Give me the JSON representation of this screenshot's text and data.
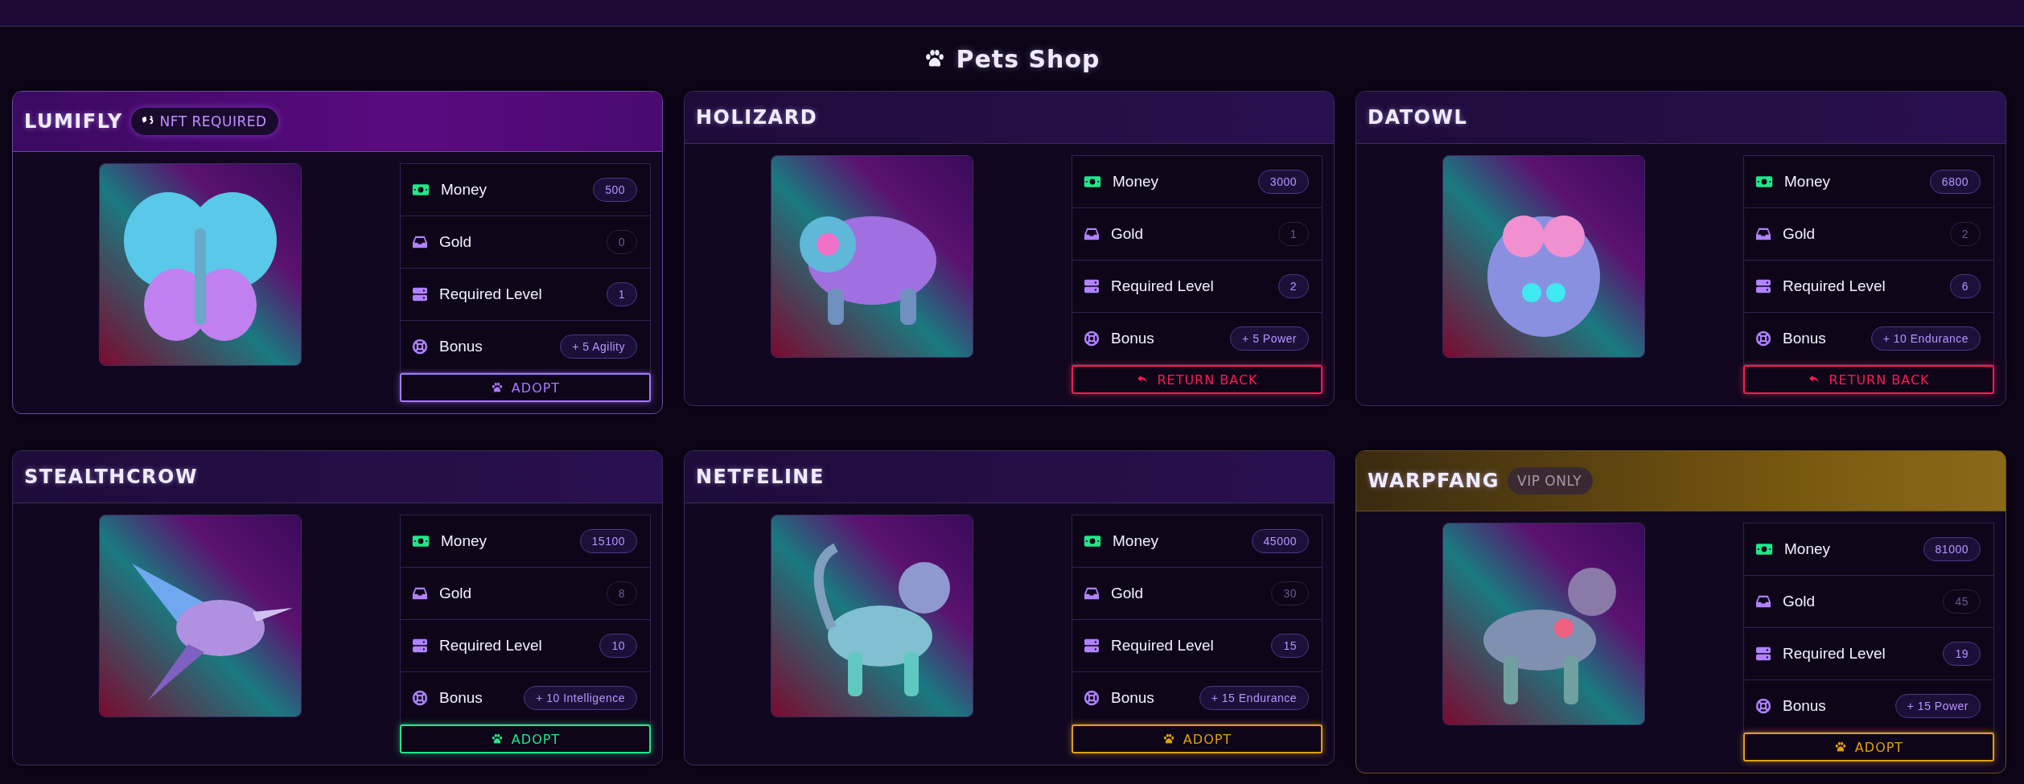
{
  "title": "Pets Shop",
  "pets": [
    {
      "name": "LUMIFLY",
      "kind": "nft",
      "badge": "NFT REQUIRED",
      "stats": [
        {
          "kind": "money",
          "label": "Money",
          "value": "500"
        },
        {
          "kind": "gold",
          "label": "Gold",
          "value": "0"
        },
        {
          "kind": "level",
          "label": "Required Level",
          "value": "1"
        },
        {
          "kind": "bonus",
          "label": "Bonus",
          "value": "+ 5 Agility"
        }
      ],
      "action": {
        "kind": "adopt",
        "label": "ADOPT",
        "color": "#a878ff"
      }
    },
    {
      "name": "HOLIZARD",
      "kind": "standard",
      "stats": [
        {
          "kind": "money",
          "label": "Money",
          "value": "3000"
        },
        {
          "kind": "gold",
          "label": "Gold",
          "value": "1"
        },
        {
          "kind": "level",
          "label": "Required Level",
          "value": "2"
        },
        {
          "kind": "bonus",
          "label": "Bonus",
          "value": "+ 5 Power"
        }
      ],
      "action": {
        "kind": "return",
        "label": "RETURN BACK",
        "color": "#ff1a55"
      }
    },
    {
      "name": "DATOWL",
      "kind": "standard",
      "stats": [
        {
          "kind": "money",
          "label": "Money",
          "value": "6800"
        },
        {
          "kind": "gold",
          "label": "Gold",
          "value": "2"
        },
        {
          "kind": "level",
          "label": "Required Level",
          "value": "6"
        },
        {
          "kind": "bonus",
          "label": "Bonus",
          "value": "+ 10 Endurance"
        }
      ],
      "action": {
        "kind": "return",
        "label": "RETURN BACK",
        "color": "#ff1a55"
      }
    },
    {
      "name": "STEALTHCROW",
      "kind": "standard",
      "stats": [
        {
          "kind": "money",
          "label": "Money",
          "value": "15100"
        },
        {
          "kind": "gold",
          "label": "Gold",
          "value": "8"
        },
        {
          "kind": "level",
          "label": "Required Level",
          "value": "10"
        },
        {
          "kind": "bonus",
          "label": "Bonus",
          "value": "+ 10 Intelligence"
        }
      ],
      "action": {
        "kind": "adopt",
        "label": "ADOPT",
        "color": "#1ee88a"
      }
    },
    {
      "name": "NETFELINE",
      "kind": "standard",
      "stats": [
        {
          "kind": "money",
          "label": "Money",
          "value": "45000"
        },
        {
          "kind": "gold",
          "label": "Gold",
          "value": "30"
        },
        {
          "kind": "level",
          "label": "Required Level",
          "value": "15"
        },
        {
          "kind": "bonus",
          "label": "Bonus",
          "value": "+ 15 Endurance"
        }
      ],
      "action": {
        "kind": "adopt",
        "label": "ADOPT",
        "color": "#e0a010"
      }
    },
    {
      "name": "WARPFANG",
      "kind": "vip",
      "badge": "VIP ONLY",
      "stats": [
        {
          "kind": "money",
          "label": "Money",
          "value": "81000"
        },
        {
          "kind": "gold",
          "label": "Gold",
          "value": "45"
        },
        {
          "kind": "level",
          "label": "Required Level",
          "value": "19"
        },
        {
          "kind": "bonus",
          "label": "Bonus",
          "value": "+ 15 Power"
        }
      ],
      "action": {
        "kind": "adopt",
        "label": "ADOPT",
        "color": "#e0a010"
      }
    }
  ]
}
